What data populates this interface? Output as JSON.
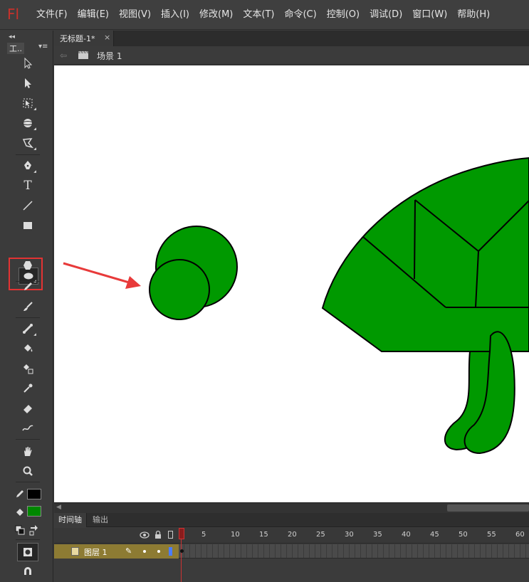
{
  "app": {
    "logo": "Fl"
  },
  "menu": [
    "文件(F)",
    "编辑(E)",
    "视图(V)",
    "插入(I)",
    "修改(M)",
    "文本(T)",
    "命令(C)",
    "控制(O)",
    "调试(D)",
    "窗口(W)",
    "帮助(H)"
  ],
  "tools_panel": {
    "title": "工..",
    "collapse": "◂◂",
    "menu": "▾≡"
  },
  "tools": {
    "selection": "selection-tool",
    "subselection": "subselection-tool",
    "free_transform": "free-transform-tool",
    "3d_rotation": "3d-rotation-tool",
    "lasso": "lasso-tool",
    "pen": "pen-tool",
    "text_glyph": "T",
    "line": "line-tool",
    "rectangle": "rectangle-tool",
    "oval": "oval-tool",
    "polystar": "polystar-tool",
    "pencil": "pencil-tool",
    "brush": "brush-tool",
    "bone": "bone-tool",
    "paint_bucket": "paint-bucket-tool",
    "ink_bottle": "ink-bottle-tool",
    "eyedropper": "eyedropper-tool",
    "eraser": "eraser-tool",
    "width": "width-tool",
    "hand": "hand-tool",
    "zoom": "zoom-tool"
  },
  "colors": {
    "stroke": "#000000",
    "fill": "#008800",
    "shape_fill": "#009900",
    "highlight": "#e23333",
    "arrow": "#e83a3a"
  },
  "document": {
    "tab_title": "无标题-1*",
    "close": "×"
  },
  "editbar": {
    "back": "⇦",
    "scene": "场景 1"
  },
  "timeline": {
    "tabs": [
      "时间轴",
      "输出"
    ],
    "frame_numbers": [
      "1",
      "5",
      "10",
      "15",
      "20",
      "25",
      "30",
      "35",
      "40",
      "45",
      "50",
      "55",
      "60"
    ],
    "layer": {
      "name": "图层 1",
      "pencil": "✎"
    },
    "current_frame": 1
  }
}
